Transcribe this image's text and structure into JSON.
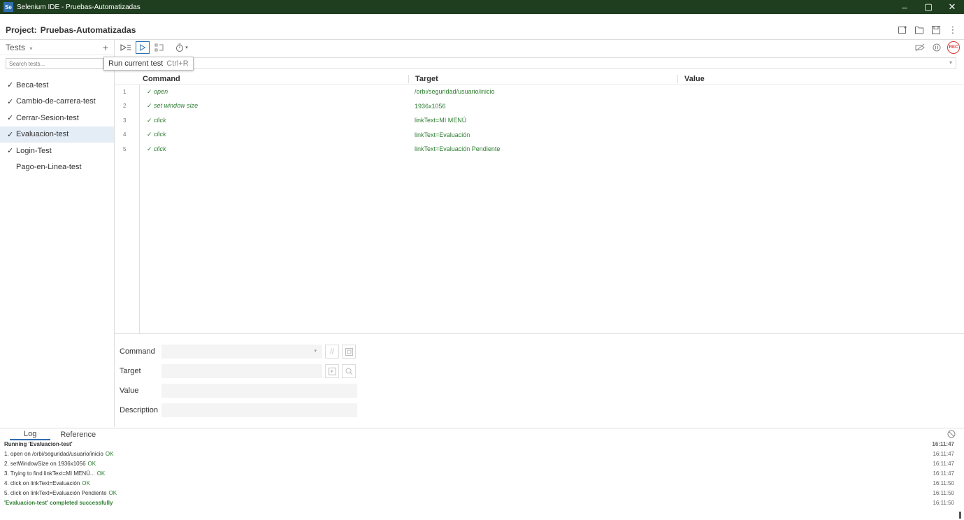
{
  "window": {
    "title": "Selenium IDE - Pruebas-Automatizadas",
    "logo": "Se",
    "minimize": "–",
    "maximize": "▢",
    "close": "✕"
  },
  "project": {
    "label": "Project:",
    "name": "Pruebas-Automatizadas"
  },
  "sidebar": {
    "section_label": "Tests",
    "section_chevron": "▾",
    "add": "+",
    "search_placeholder": "Search tests...",
    "tests": [
      {
        "name": "Beca-test",
        "passed": true
      },
      {
        "name": "Cambio-de-carrera-test",
        "passed": true
      },
      {
        "name": "Cerrar-Sesion-test",
        "passed": true
      },
      {
        "name": "Evaluacion-test",
        "passed": true,
        "selected": true
      },
      {
        "name": "Login-Test",
        "passed": true
      },
      {
        "name": "Pago-en-Linea-test",
        "passed": false
      }
    ]
  },
  "tooltip": {
    "text": "Run current test",
    "shortcut": "Ctrl+R"
  },
  "table": {
    "headers": {
      "command": "Command",
      "target": "Target",
      "value": "Value"
    },
    "rows": [
      {
        "num": "1",
        "command": "open",
        "target": "/orbi/seguridad/usuario/inicio",
        "value": ""
      },
      {
        "num": "2",
        "command": "set window size",
        "target": "1936x1056",
        "value": ""
      },
      {
        "num": "3",
        "command": "click",
        "target": "linkText=MI MENÚ",
        "value": ""
      },
      {
        "num": "4",
        "command": "click",
        "target": "linkText=Evaluación",
        "value": ""
      },
      {
        "num": "5",
        "command": "click",
        "target": "linkText=Evaluación Pendiente",
        "value": ""
      }
    ]
  },
  "editor": {
    "command_label": "Command",
    "target_label": "Target",
    "value_label": "Value",
    "description_label": "Description"
  },
  "log": {
    "tabs": [
      "Log",
      "Reference"
    ],
    "lines": [
      {
        "text": "Running 'Evaluacion-test'",
        "ok": "",
        "time": "16:11:47",
        "style": "bold"
      },
      {
        "text": "1.  open on /orbi/seguridad/usuario/inicio",
        "ok": "OK",
        "time": "16:11:47",
        "style": ""
      },
      {
        "text": "2.  setWindowSize on 1936x1056",
        "ok": "OK",
        "time": "16:11:47",
        "style": ""
      },
      {
        "text": "3.  Trying to find linkText=MI MENÚ...",
        "ok": "OK",
        "time": "16:11:47",
        "style": ""
      },
      {
        "text": "4.  click on linkText=Evaluación",
        "ok": "OK",
        "time": "16:11:50",
        "style": ""
      },
      {
        "text": "5.  click on linkText=Evaluación Pendiente",
        "ok": "OK",
        "time": "16:11:50",
        "style": ""
      },
      {
        "text": "'Evaluacion-test' completed successfully",
        "ok": "",
        "time": "16:11:50",
        "style": "success"
      }
    ]
  },
  "toolbar": {
    "rec_label": "REC"
  },
  "colors": {
    "titlebar": "#1f3d1f",
    "accent": "#2f6fb0",
    "pass": "#2e7d32",
    "rec": "#dd3333"
  }
}
